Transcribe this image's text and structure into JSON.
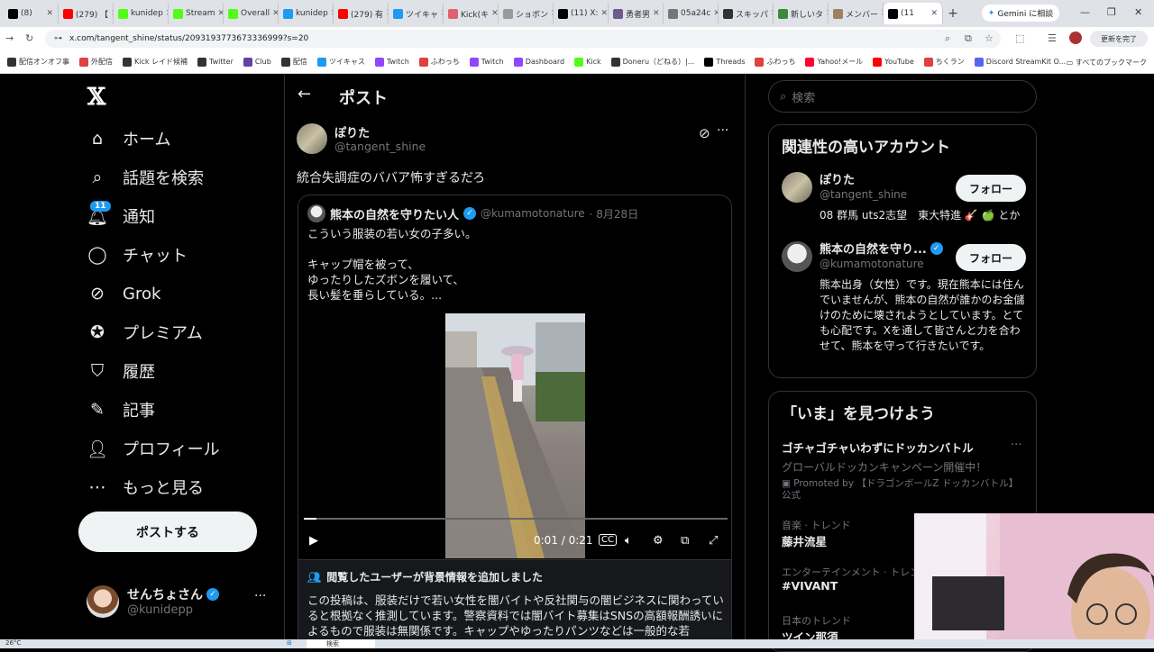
{
  "browser": {
    "tabs": [
      {
        "label": "(8)",
        "color": "#000000"
      },
      {
        "label": "(279) 【",
        "color": "#ff0000"
      },
      {
        "label": "kunidep",
        "color": "#53fc18"
      },
      {
        "label": "Stream",
        "color": "#53fc18"
      },
      {
        "label": "Overall",
        "color": "#53fc18"
      },
      {
        "label": "kunidep",
        "color": "#1d9bf0"
      },
      {
        "label": "(279) 有",
        "color": "#ff0000"
      },
      {
        "label": "ツイキャ",
        "color": "#1d9bf0"
      },
      {
        "label": "Kick(キ",
        "color": "#e06070"
      },
      {
        "label": "ショボン",
        "color": "#999999"
      },
      {
        "label": "(11) X:",
        "color": "#000000"
      },
      {
        "label": "勇者男",
        "color": "#6e5a8a"
      },
      {
        "label": "05a24c",
        "color": "#777777"
      },
      {
        "label": "スキッパ",
        "color": "#333333"
      },
      {
        "label": "新しいタ",
        "color": "#3b8a3b"
      },
      {
        "label": "メンバー",
        "color": "#a08060"
      },
      {
        "label": "(11",
        "color": "#000000",
        "active": true
      }
    ],
    "new_tab": "+",
    "gemini_label": "Gemini に相談",
    "url": "x.com/tangent_shine/status/2093193773673336999?s=20",
    "update_label": "更新を完了",
    "bookmarks": [
      {
        "label": "配信オンオフ事",
        "color": "#333333"
      },
      {
        "label": "外配信",
        "color": "#e04040"
      },
      {
        "label": "Kick レイド候補",
        "color": "#333333"
      },
      {
        "label": "Twitter",
        "color": "#333333"
      },
      {
        "label": "Club",
        "color": "#6441a5"
      },
      {
        "label": "配信",
        "color": "#333333"
      },
      {
        "label": "ツイキャス",
        "color": "#1d9bf0"
      },
      {
        "label": "Twitch",
        "color": "#9146ff"
      },
      {
        "label": "ふわっち",
        "color": "#e04040"
      },
      {
        "label": "Twitch",
        "color": "#9146ff"
      },
      {
        "label": "Dashboard",
        "color": "#9146ff"
      },
      {
        "label": "Kick",
        "color": "#53fc18"
      },
      {
        "label": "Doneru（どねる）|...",
        "color": "#333333"
      },
      {
        "label": "Threads",
        "color": "#000000"
      },
      {
        "label": "ふわっち",
        "color": "#e04040"
      },
      {
        "label": "Yahoo!メール",
        "color": "#ff0033"
      },
      {
        "label": "YouTube",
        "color": "#ff0000"
      },
      {
        "label": "ちくラン",
        "color": "#e04040"
      },
      {
        "label": "Discord StreamKit O...",
        "color": "#5865f2"
      }
    ],
    "all_bookmarks": "すべてのブックマーク"
  },
  "nav": {
    "items": [
      {
        "label": "ホーム",
        "icon": "home-icon"
      },
      {
        "label": "話題を検索",
        "icon": "search-icon"
      },
      {
        "label": "通知",
        "icon": "bell-icon"
      },
      {
        "label": "チャット",
        "icon": "chat-icon"
      },
      {
        "label": "Grok",
        "icon": "grok-icon"
      },
      {
        "label": "プレミアム",
        "icon": "premium-icon"
      },
      {
        "label": "履歴",
        "icon": "bookmark-icon"
      },
      {
        "label": "記事",
        "icon": "article-icon"
      },
      {
        "label": "プロフィール",
        "icon": "profile-icon"
      },
      {
        "label": "もっと見る",
        "icon": "more-icon"
      }
    ],
    "notification_badge": "11",
    "post_button": "ポストする",
    "account": {
      "name": "せんちょさん",
      "handle": "@kunidepp"
    }
  },
  "main": {
    "title": "ポスト",
    "author": {
      "name": "ぽりた",
      "handle": "@tangent_shine"
    },
    "text": "統合失調症のババア怖すぎるだろ",
    "quote": {
      "name": "熊本の自然を守りたい人",
      "handle": "@kumamotonature",
      "date": "· 8月28日",
      "body": "こういう服装の若い女の子多い。\n\nキャップ帽を被って、\nゆったりしたズボンを履いて、\n長い髪を垂らしている。..."
    },
    "video": {
      "time": "0:01 / 0:21",
      "progress": 0.03
    },
    "community_note": {
      "header": "閲覧したユーザーが背景情報を追加しました",
      "body": "この投稿は、服装だけで若い女性を闇バイトや反社関与の闇ビジネスに関わっていると根拠なく推測しています。警察資料では闇バイト募集はSNSの高額報酬誘いによるもので服装は無関係です。キャップやゆったりパンツなどは一般的な若"
    }
  },
  "sidebar": {
    "search_placeholder": "検索",
    "relevant": {
      "title": "関連性の高いアカウント",
      "accounts": [
        {
          "name": "ぽりた",
          "handle": "@tangent_shine",
          "bio": "08 群馬 uts2志望　東大特進 🎸 🍏 とか",
          "follow": "フォロー"
        },
        {
          "name": "熊本の自然を守り...",
          "handle": "@kumamotonature",
          "bio": "熊本出身（女性）です。現在熊本には住んでいませんが、熊本の自然が誰かのお金儲けのために壊されようとしています。とても心配です。Xを通して皆さんと力を合わせて、熊本を守って行きたいです。",
          "follow": "フォロー"
        }
      ]
    },
    "trends": {
      "title": "「いま」を見つけよう",
      "items": [
        {
          "category": "",
          "name": "ゴチャゴチャいわずにドッカンバトル",
          "sub": "グローバルドッカンキャンペーン開催中！",
          "promo": "Promoted by 【ドラゴンボールZ ドッカンバトル】公式"
        },
        {
          "category": "音楽 · トレンド",
          "name": "藤井流星"
        },
        {
          "category": "エンターテインメント · トレンド",
          "name": "#VIVANT"
        },
        {
          "category": "日本のトレンド",
          "name": "ツイン那須"
        }
      ]
    }
  },
  "taskbar": {
    "temp": "26°C",
    "search": "検索"
  }
}
